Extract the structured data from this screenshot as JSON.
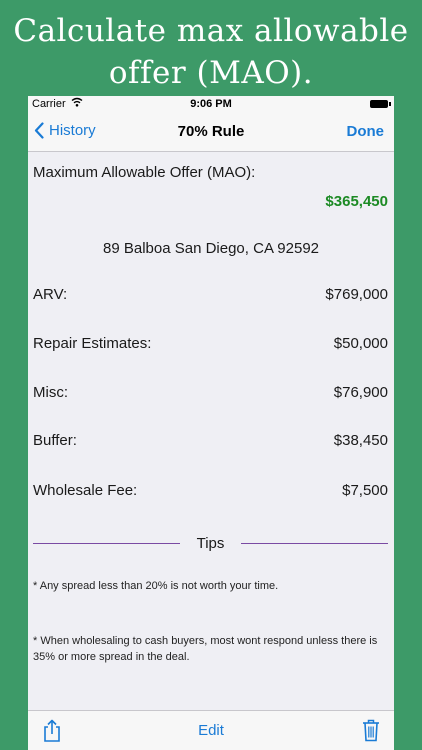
{
  "headline": {
    "line1": "Calculate max allowable",
    "line2": "offer (MAO)."
  },
  "status": {
    "carrier": "Carrier",
    "time": "9:06 PM"
  },
  "nav": {
    "back_label": "History",
    "title": "70% Rule",
    "done_label": "Done"
  },
  "mao": {
    "label": "Maximum Allowable Offer (MAO):",
    "value": "$365,450"
  },
  "address": "89 Balboa San Diego, CA 92592",
  "rows": [
    {
      "label": "ARV:",
      "value": "$769,000"
    },
    {
      "label": "Repair Estimates:",
      "value": "$50,000"
    },
    {
      "label": "Misc:",
      "value": "$76,900"
    },
    {
      "label": "Buffer:",
      "value": "$38,450"
    },
    {
      "label": "Wholesale Fee:",
      "value": "$7,500"
    }
  ],
  "tips": {
    "heading": "Tips",
    "items": [
      "* Any spread less than 20% is not worth your time.",
      "* When wholesaling to cash buyers, most wont respond unless there is 35% or more spread in the deal."
    ]
  },
  "toolbar": {
    "edit_label": "Edit"
  },
  "colors": {
    "background": "#3d9a68",
    "accent": "#1a7bd5",
    "mao_value": "#1c8a24",
    "divider": "#7a4aa3"
  }
}
